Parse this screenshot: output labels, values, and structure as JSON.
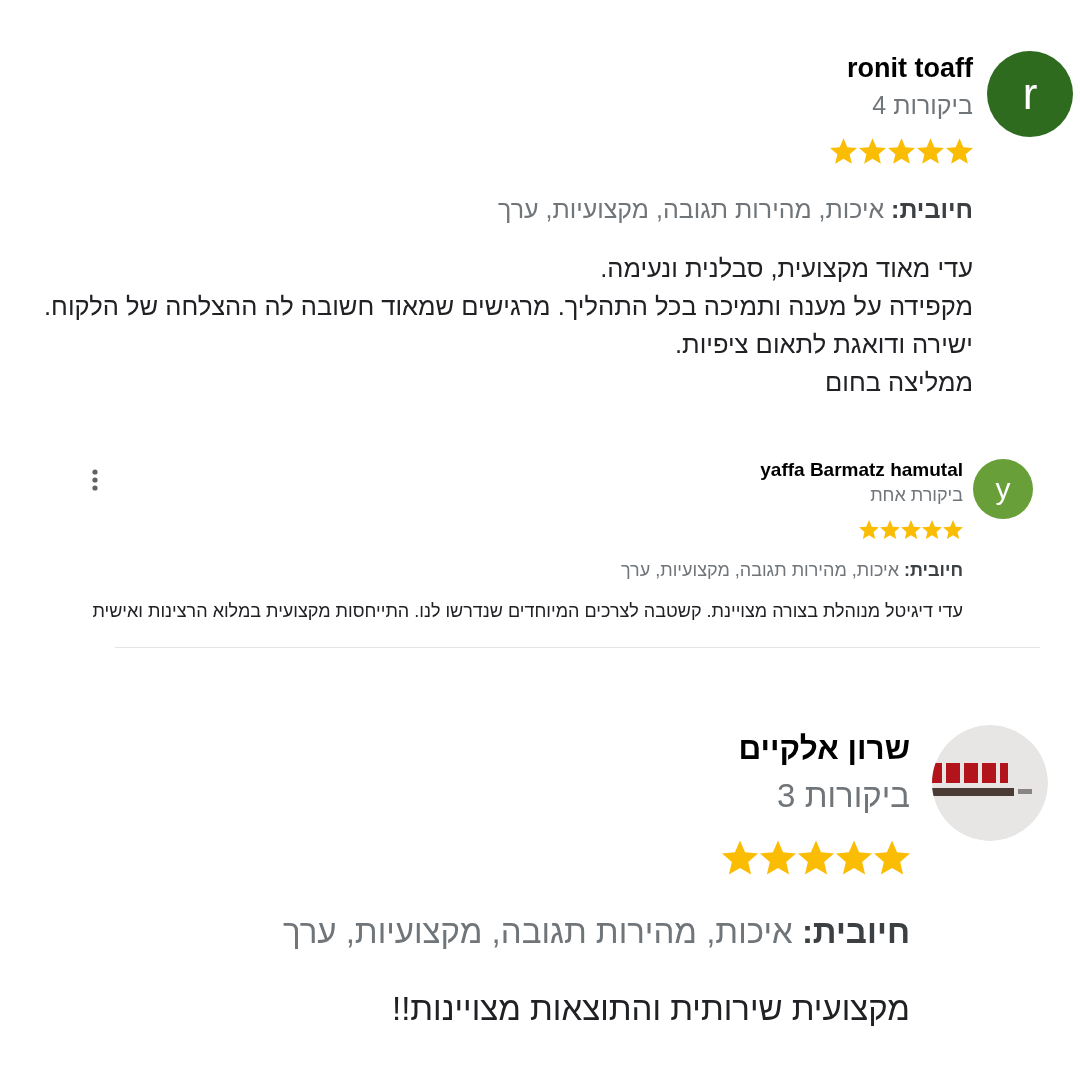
{
  "reviews": [
    {
      "avatar": {
        "kind": "letter",
        "letter": "r",
        "color": "#2e6b1e"
      },
      "name": "ronit toaff",
      "review_count": "4 ביקורות",
      "stars": 5,
      "positive": "**חיובית:** איכות, מהירות תגובה, מקצועיות, ערך",
      "text": "עדי מאוד מקצועית, סבלנית ונעימה.\nמקפידה על מענה ותמיכה בכל התהליך. מרגישים שמאוד חשובה לה ההצלחה של הלקוח.\nישירה ודואגת לתאום ציפיות.\nממליצה בחום",
      "menu_button": false,
      "divider_below": false
    },
    {
      "avatar": {
        "kind": "letter",
        "letter": "y",
        "color": "#689f38"
      },
      "name": "yaffa Barmatz hamutal",
      "review_count": "ביקורת אחת",
      "stars": 5,
      "positive": "**חיובית:** איכות, מהירות תגובה, מקצועיות, ערך",
      "text": "עדי דיגיטל מנוהלת בצורה מצויינת. קשטבה לצרכים המיוחדים שנדרשו לנו. התייחסות מקצועית במלוא הרצינות ואישית",
      "menu_button": true,
      "divider_below": true
    },
    {
      "avatar": {
        "kind": "logo"
      },
      "name": "שרון אלקיים",
      "review_count": "3 ביקורות",
      "stars": 5,
      "positive": "**חיובית:** איכות, מהירות תגובה, מקצועיות, ערך",
      "text": "מקצועית שירותית והתוצאות מצויינות!!",
      "menu_button": false,
      "divider_below": false
    }
  ]
}
